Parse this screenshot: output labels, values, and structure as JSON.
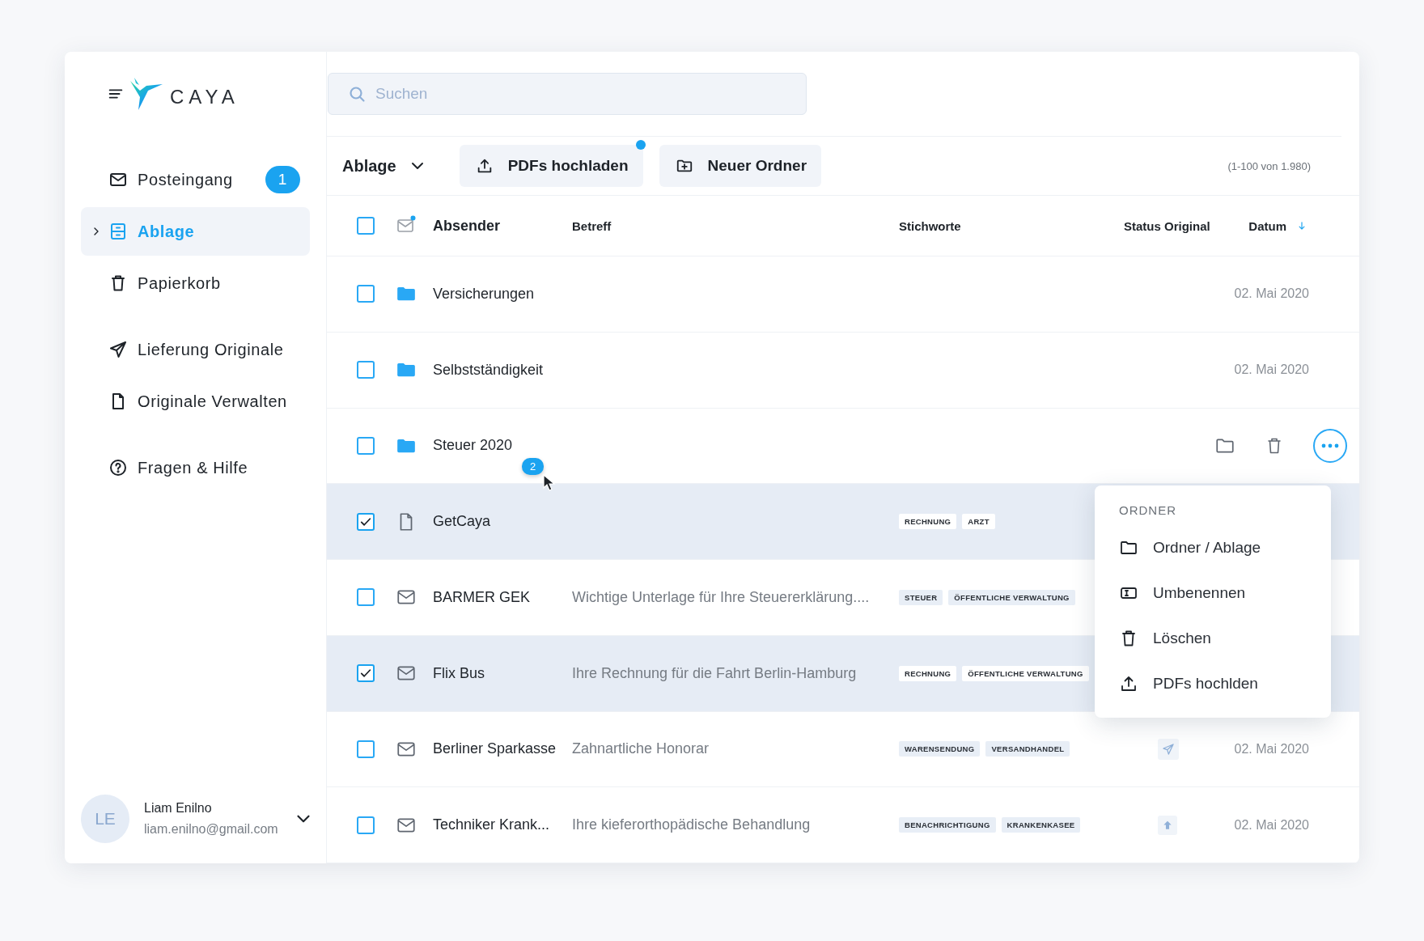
{
  "app": {
    "logo": "CAYA"
  },
  "sidebar": {
    "sections": [
      {
        "items": [
          {
            "label": "Posteingang",
            "badge": "1",
            "selected": false,
            "expandable": false
          },
          {
            "label": "Ablage",
            "selected": true,
            "expandable": true
          },
          {
            "label": "Papierkorb",
            "selected": false,
            "expandable": false
          }
        ]
      },
      {
        "items": [
          {
            "label": "Lieferung Originale",
            "selected": false,
            "expandable": false
          },
          {
            "label": "Originale Verwalten",
            "selected": false,
            "expandable": false
          }
        ]
      },
      {
        "items": [
          {
            "label": "Fragen & Hilfe",
            "selected": false,
            "expandable": false
          }
        ]
      }
    ],
    "user": {
      "initials": "LE",
      "name": "Liam Enilno",
      "email": "liam.enilno@gmail.com"
    }
  },
  "search": {
    "placeholder": "Suchen"
  },
  "toolbar": {
    "folder": "Ablage",
    "buttons": [
      {
        "label": "PDFs hochladen",
        "notify": true
      },
      {
        "label": "Neuer Ordner",
        "notify": false
      }
    ],
    "count": "(1-100 von 1.980)"
  },
  "table": {
    "select_all_checked": false,
    "columns": [
      {
        "label": "Absender",
        "sorted": false
      },
      {
        "label": "Betreff",
        "sorted": false
      },
      {
        "label": "Stichworte",
        "sorted": false
      },
      {
        "label": "Status Original",
        "sorted": false
      },
      {
        "label": "Datum",
        "sorted": true
      }
    ],
    "rows": [
      {
        "kind": "folder",
        "checked": false,
        "hovered": false,
        "sender": "Versicherungen",
        "date": "02. Mai 2020"
      },
      {
        "kind": "folder",
        "checked": false,
        "hovered": false,
        "sender": "Selbstständigkeit",
        "date": "02. Mai 2020"
      },
      {
        "kind": "folder",
        "checked": false,
        "hovered": true,
        "sender": "Steuer 2020",
        "drag_count": "2"
      },
      {
        "kind": "document",
        "checked": true,
        "hovered": false,
        "sender": "GetCaya",
        "tags": [
          "RECHNUNG",
          "ARZT"
        ]
      },
      {
        "kind": "mail",
        "checked": false,
        "hovered": false,
        "sender": "BARMER GEK",
        "subject": "Wichtige Unterlage für Ihre Steuererklärung....",
        "tags": [
          "STEUER",
          "ÖFFENTLICHE VERWALTUNG"
        ]
      },
      {
        "kind": "mail",
        "checked": true,
        "hovered": false,
        "sender": "Flix Bus",
        "subject": "Ihre Rechnung für die Fahrt Berlin-Hamburg",
        "tags": [
          "RECHNUNG",
          "ÖFFENTLICHE VERWALTUNG"
        ]
      },
      {
        "kind": "mail",
        "checked": false,
        "hovered": false,
        "sender": "Berliner Sparkasse",
        "subject": "Zahnartliche Honorar",
        "tags": [
          "WARENSENDUNG",
          "VERSANDHANDEL"
        ],
        "status": {
          "kind": "sent"
        },
        "date": "02. Mai 2020"
      },
      {
        "kind": "mail",
        "checked": false,
        "hovered": false,
        "sender": "Techniker Krank...",
        "subject": "Ihre kieferorthopädische Behandlung",
        "tags": [
          "BENACHRICHTIGUNG",
          "KRANKENKASEE"
        ],
        "status": {
          "kind": "uploaded"
        },
        "date": "02. Mai 2020"
      }
    ]
  },
  "menu": {
    "title": "ORDNER",
    "items": [
      "Ordner / Ablage",
      "Umbenennen",
      "Löschen",
      "PDFs hochlden"
    ]
  }
}
